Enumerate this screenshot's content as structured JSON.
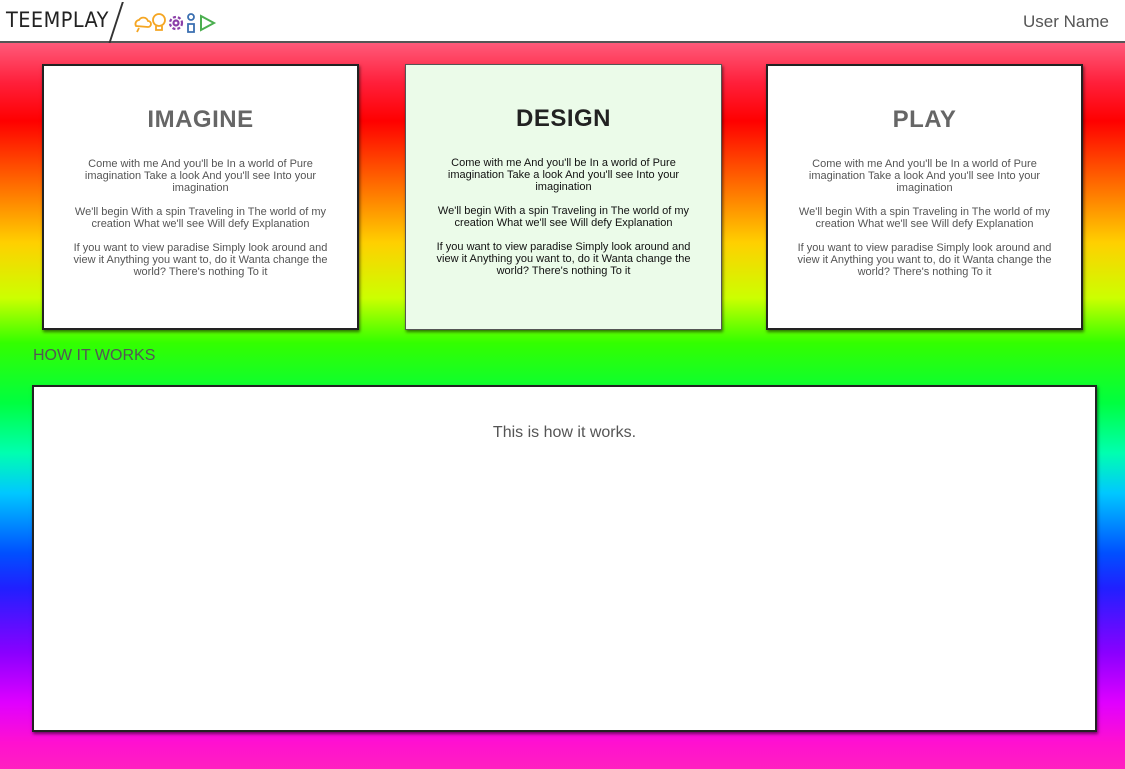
{
  "header": {
    "brand": "TEEMPLAY",
    "logo_icons": [
      "cloud-icon",
      "lightbulb-icon",
      "gear-icon",
      "pawn-icon",
      "play-icon"
    ],
    "user_name": "User Name"
  },
  "cards": [
    {
      "title": "IMAGINE",
      "paragraphs": [
        "Come with me And you'll be In a world of Pure imagination Take a look And you'll see Into your imagination",
        "We'll begin With a spin Traveling in The world of my creation What we'll see Will defy Explanation",
        "If you want to view paradise Simply look around and view it Anything you want to, do it Wanta change the world? There's nothing To it"
      ]
    },
    {
      "title": "DESIGN",
      "active": true,
      "paragraphs": [
        "Come with me And you'll be In a world of Pure imagination Take a look And you'll see Into your imagination",
        "We'll begin With a spin Traveling in The world of my creation What we'll see Will defy Explanation",
        "If you want to view paradise Simply look around and view it Anything you want to, do it Wanta change the world? There's nothing To it"
      ]
    },
    {
      "title": "PLAY",
      "paragraphs": [
        "Come with me And you'll be In a world of Pure imagination Take a look And you'll see Into your imagination",
        "We'll begin With a spin Traveling in The world of my creation What we'll see Will defy Explanation",
        "If you want to view paradise Simply look around and view it Anything you want to, do it Wanta change the world? There's nothing To it"
      ]
    }
  ],
  "how_it_works": {
    "label": "HOW IT WORKS",
    "text": "This is how it works."
  },
  "colors": {
    "logo_orange": "#f5a623",
    "logo_purple": "#8b3fa8",
    "logo_green": "#4caf50",
    "logo_blue": "#3a6fb0",
    "active_card_bg": "#ebfbe9"
  }
}
